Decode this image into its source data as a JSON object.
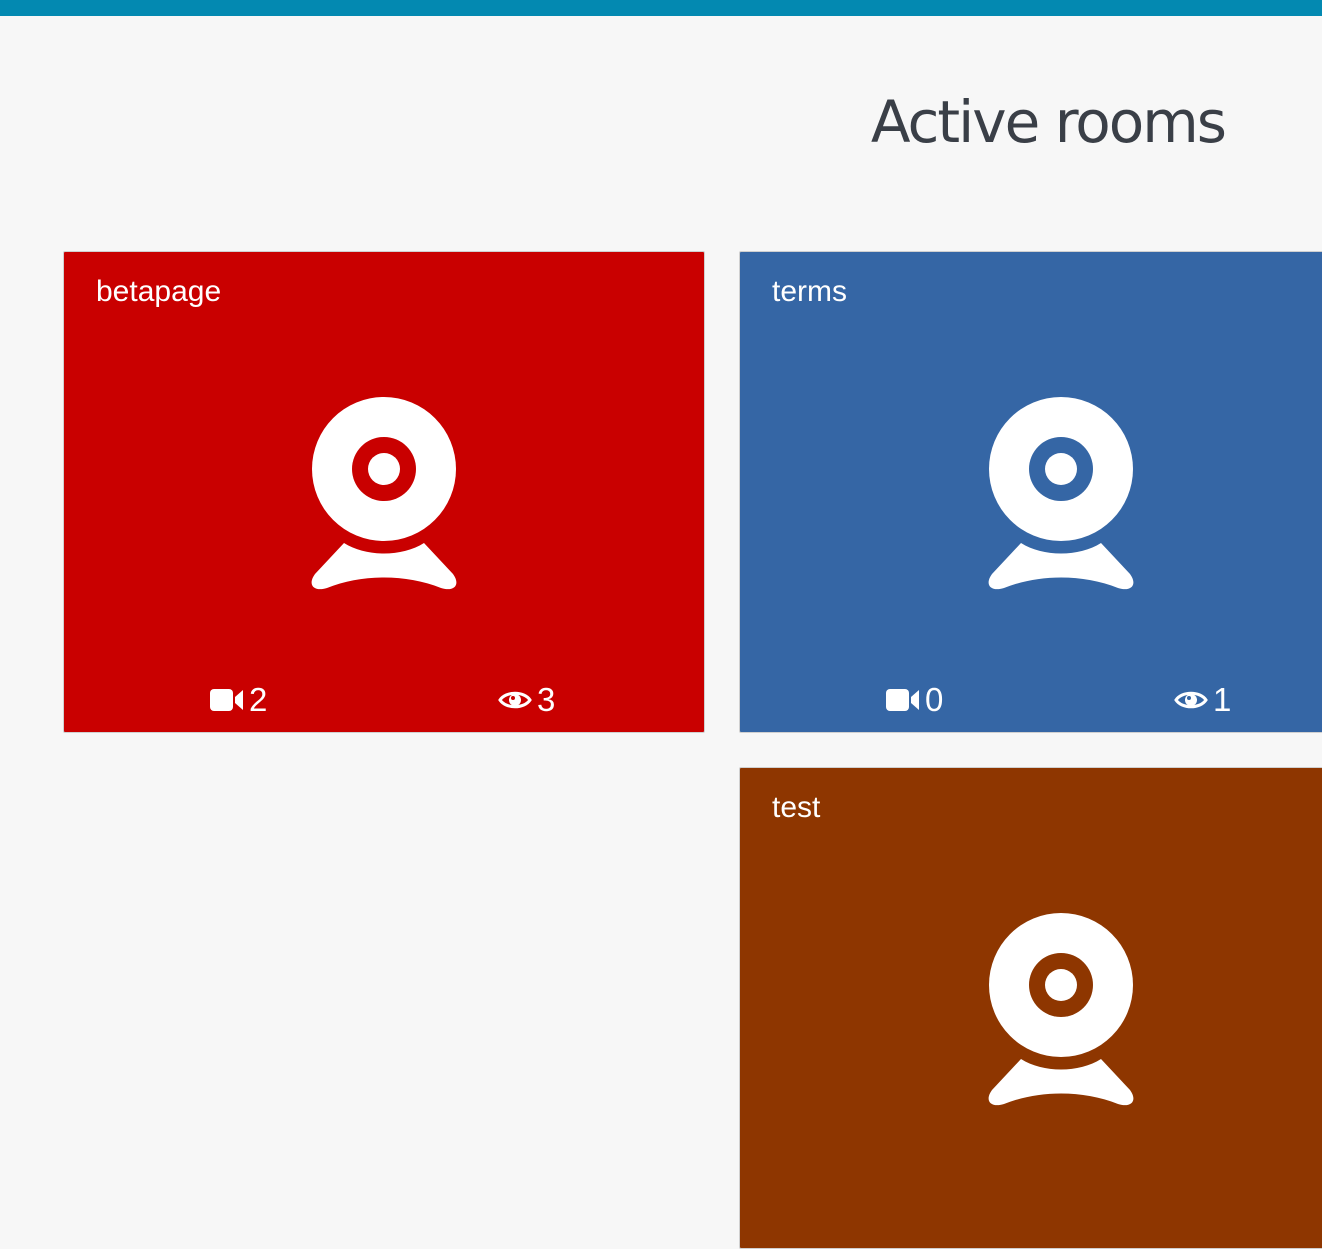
{
  "header": {
    "bar_color": "#0389b1"
  },
  "page": {
    "title": "Active rooms"
  },
  "rooms": [
    {
      "name": "betapage",
      "color": "#c90000",
      "publishers": "2",
      "viewers": "3",
      "icon": "webcam-icon"
    },
    {
      "name": "terms",
      "color": "#3566a5",
      "publishers": "0",
      "viewers": "1",
      "icon": "webcam-icon"
    },
    {
      "name": "test",
      "color": "#8e3600",
      "publishers": "",
      "viewers": "",
      "icon": "webcam-icon"
    }
  ],
  "icons": {
    "publishers": "video-camera-icon",
    "viewers": "eye-icon"
  }
}
